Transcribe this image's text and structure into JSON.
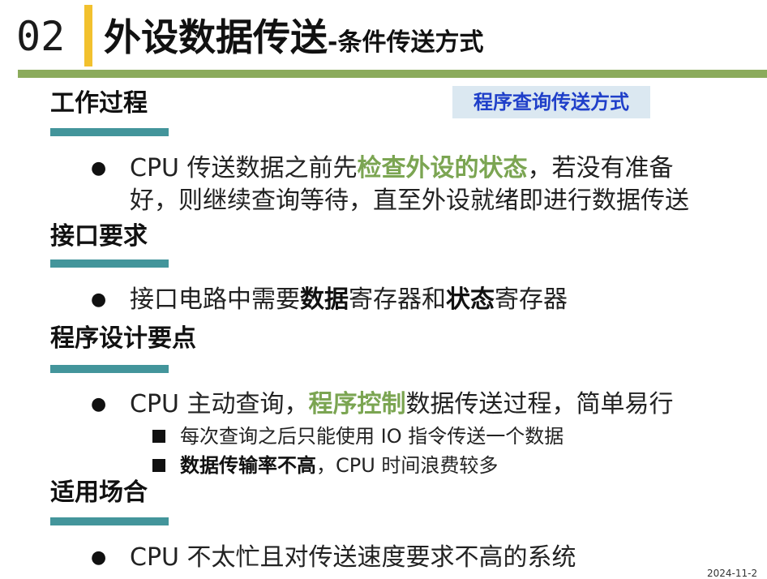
{
  "header": {
    "number": "02",
    "title_main": "外设数据传送",
    "title_dash": "-",
    "title_sub": "条件传送方式"
  },
  "tag": "程序查询传送方式",
  "sections": [
    {
      "heading": "工作过程",
      "bullet": {
        "line1_a": "CPU 传送数据之前先",
        "line1_hl": "检查外设的状态",
        "line1_b": "，若没有准备",
        "line2": "好，则继续查询等待，直至外设就绪即进行数据传送"
      }
    },
    {
      "heading": "接口要求",
      "bullet": {
        "a": "接口电路中需要",
        "b1": "数据",
        "c": "寄存器和",
        "b2": "状态",
        "d": "寄存器"
      }
    },
    {
      "heading": "程序设计要点",
      "bullet": {
        "a": "CPU 主动查询，",
        "hl": "程序控制",
        "b": "数据传送过程，简单易行"
      },
      "subs": [
        {
          "text": "每次查询之后只能使用 IO 指令传送一个数据"
        },
        {
          "bold": "数据传输率不高",
          "text": "，CPU 时间浪费较多"
        }
      ]
    },
    {
      "heading": "适用场合",
      "bullet": {
        "text": "CPU 不太忙且对传送速度要求不高的系统"
      }
    }
  ],
  "footer": {
    "date": "2024-11-2"
  },
  "colors": {
    "accent_green": "#7ba552",
    "rule_green": "#8bab5c",
    "teal": "#43959b",
    "yellow": "#f2c12e",
    "tag_bg": "#dbe8f1",
    "tag_text": "#1f3fc9"
  }
}
